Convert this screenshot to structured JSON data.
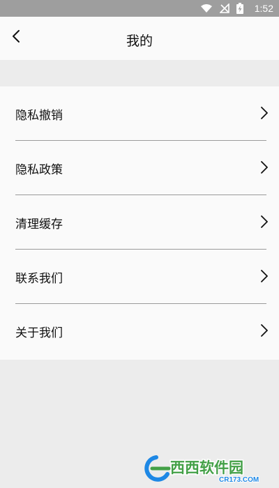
{
  "status_bar": {
    "time": "1:52",
    "icons": [
      "wifi-icon",
      "no-signal-icon",
      "battery-charging-icon"
    ]
  },
  "title_bar": {
    "title": "我的",
    "back_icon": "chevron-left-icon"
  },
  "menu": {
    "items": [
      {
        "label": "隐私撤销",
        "icon": "chevron-right-icon"
      },
      {
        "label": "隐私政策",
        "icon": "chevron-right-icon"
      },
      {
        "label": "清理缓存",
        "icon": "chevron-right-icon"
      },
      {
        "label": "联系我们",
        "icon": "chevron-right-icon"
      },
      {
        "label": "关于我们",
        "icon": "chevron-right-icon"
      }
    ]
  },
  "watermark": {
    "brand_text": "西西软件园",
    "url_text": "CR173.COM"
  },
  "colors": {
    "status_bar": "#9e9e9e",
    "surface": "#fafafa",
    "background": "#ececec",
    "text": "#111111",
    "divider": "#9a9a9a"
  }
}
